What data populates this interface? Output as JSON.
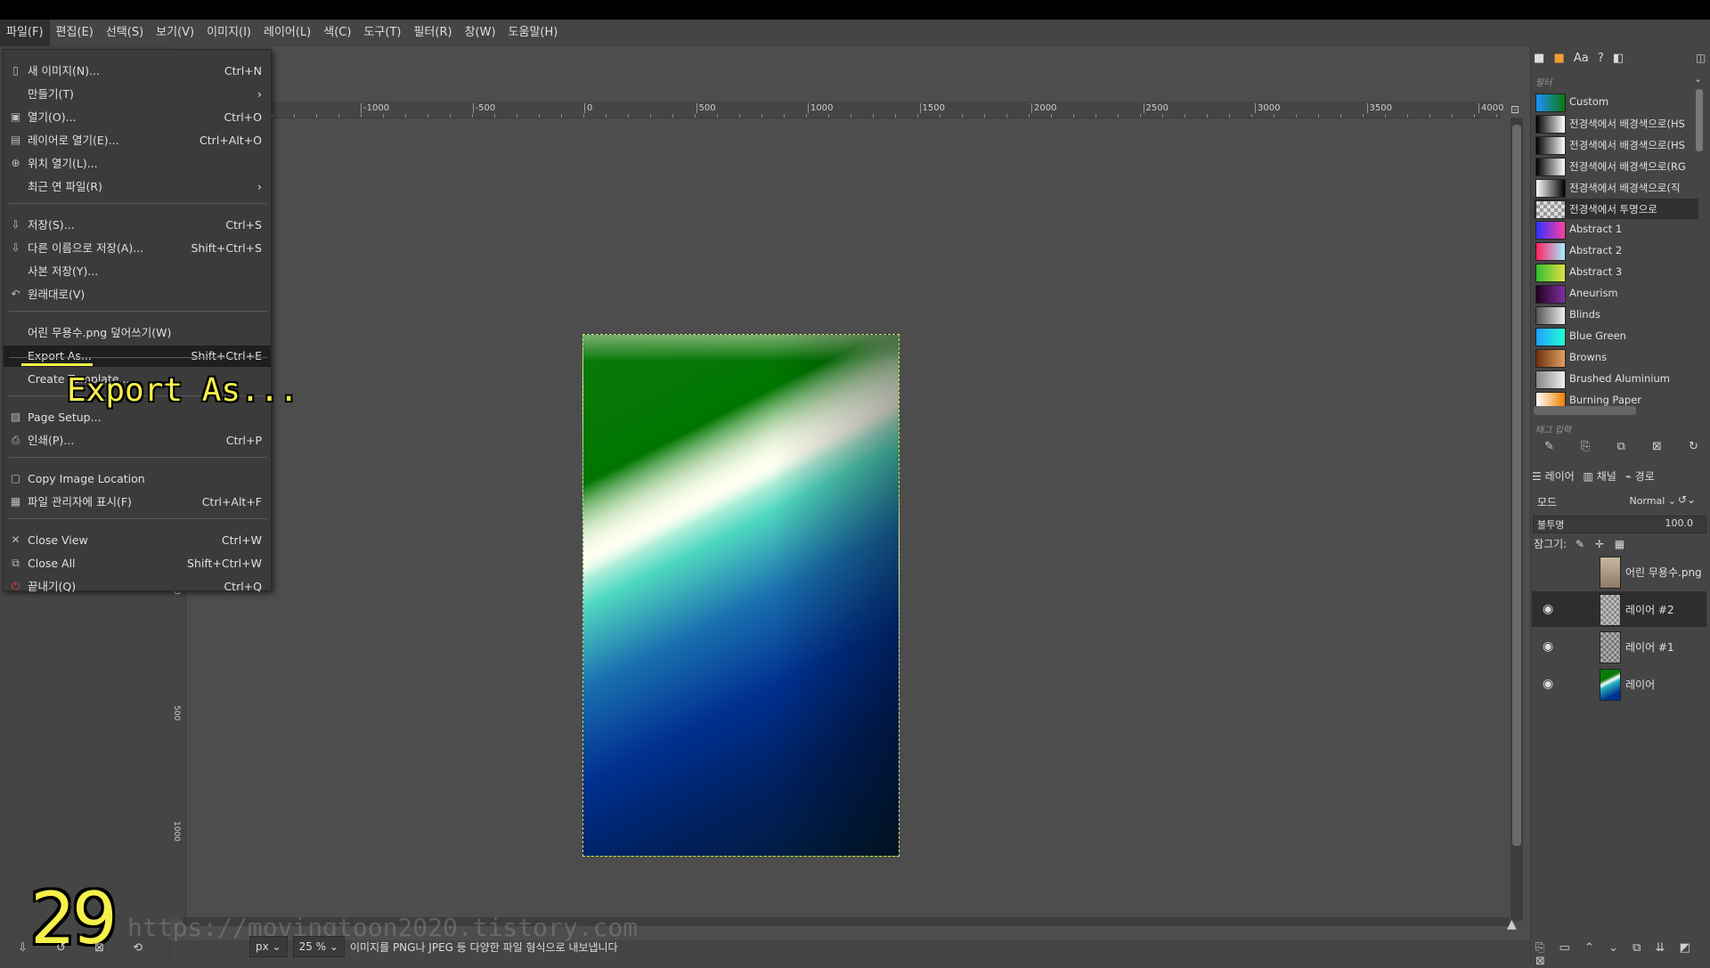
{
  "menubar": [
    "파일(F)",
    "편집(E)",
    "선택(S)",
    "보기(V)",
    "이미지(I)",
    "레이어(L)",
    "색(C)",
    "도구(T)",
    "필터(R)",
    "창(W)",
    "도움말(H)"
  ],
  "file_menu": [
    {
      "label": "새 이미지(N)...",
      "accel": "Ctrl+N",
      "icon": "new-image-icon"
    },
    {
      "label": "만들기(T)",
      "accel": "›",
      "icon": ""
    },
    {
      "label": "열기(O)...",
      "accel": "Ctrl+O",
      "icon": "open-icon"
    },
    {
      "label": "레이어로 열기(E)...",
      "accel": "Ctrl+Alt+O",
      "icon": "open-as-layer-icon"
    },
    {
      "label": "위치 열기(L)...",
      "accel": "",
      "icon": "open-location-icon"
    },
    {
      "label": "최근 연 파일(R)",
      "accel": "›",
      "icon": ""
    },
    {
      "label": "저장(S)...",
      "accel": "Ctrl+S",
      "icon": "save-icon"
    },
    {
      "label": "다른 이름으로 저장(A)...",
      "accel": "Shift+Ctrl+S",
      "icon": "save-as-icon"
    },
    {
      "label": "사본 저장(Y)...",
      "accel": "",
      "icon": ""
    },
    {
      "label": "원래대로(V)",
      "accel": "",
      "icon": "revert-icon"
    },
    {
      "label": "어린 무용수.png 덮어쓰기(W)",
      "accel": "",
      "icon": ""
    },
    {
      "label": "Export As...",
      "accel": "Shift+Ctrl+E",
      "icon": ""
    },
    {
      "label": "Create Template...",
      "accel": "",
      "icon": ""
    },
    {
      "label": "Page Setup...",
      "accel": "",
      "icon": "page-setup-icon"
    },
    {
      "label": "인쇄(P)...",
      "accel": "Ctrl+P",
      "icon": "print-icon"
    },
    {
      "label": "Copy Image Location",
      "accel": "",
      "icon": "copy-location-icon"
    },
    {
      "label": "파일 관리자에 표시(F)",
      "accel": "Ctrl+Alt+F",
      "icon": "file-manager-icon"
    },
    {
      "label": "Close View",
      "accel": "Ctrl+W",
      "icon": "close-icon"
    },
    {
      "label": "Close All",
      "accel": "Shift+Ctrl+W",
      "icon": "close-all-icon"
    },
    {
      "label": "끝내기(Q)",
      "accel": "Ctrl+Q",
      "icon": "quit-icon"
    }
  ],
  "overlay": {
    "export_caption": "Export As...",
    "step_number": "29",
    "watermark": "https://movingtoon2020.tistory.com"
  },
  "ruler_top_labels": [
    "-1000",
    "-500",
    "0",
    "500",
    "1000",
    "1500",
    "2000",
    "2500",
    "3000",
    "3500",
    "4000"
  ],
  "ruler_left_labels": [
    "0",
    "500",
    "1000"
  ],
  "statusbar": {
    "unit": "px",
    "zoom": "25 %",
    "message": "이미지를 PNG나 JPEG 등 다양한 파일 형식으로 내보냅니다"
  },
  "gradients": {
    "header": "필터",
    "tag_placeholder": "태그 입력",
    "items": [
      {
        "name": "Custom",
        "colors": [
          "#1e90ff",
          "#0a7a0a"
        ]
      },
      {
        "name": "전경색에서 배경색으로(HS",
        "colors": [
          "#000",
          "#fff"
        ]
      },
      {
        "name": "전경색에서 배경색으로(HS",
        "colors": [
          "#000",
          "#fff"
        ]
      },
      {
        "name": "전경색에서 배경색으로(RG",
        "colors": [
          "#000",
          "#fff"
        ]
      },
      {
        "name": "전경색에서 배경색으로(직",
        "colors": [
          "#fff",
          "#000"
        ]
      },
      {
        "name": "전경색에서 투명으로",
        "colors": [
          "#ddd",
          "#ddd"
        ]
      },
      {
        "name": "Abstract 1",
        "colors": [
          "#3030ff",
          "#ff40a0"
        ]
      },
      {
        "name": "Abstract 2",
        "colors": [
          "#ff2060",
          "#a0f0ff"
        ]
      },
      {
        "name": "Abstract 3",
        "colors": [
          "#30c030",
          "#e0e040"
        ]
      },
      {
        "name": "Aneurism",
        "colors": [
          "#200020",
          "#8030a0"
        ]
      },
      {
        "name": "Blinds",
        "colors": [
          "#555",
          "#eee"
        ]
      },
      {
        "name": "Blue Green",
        "colors": [
          "#20a0ff",
          "#20ffd0"
        ]
      },
      {
        "name": "Browns",
        "colors": [
          "#703010",
          "#e0a060"
        ]
      },
      {
        "name": "Brushed Aluminium",
        "colors": [
          "#888",
          "#eee"
        ]
      },
      {
        "name": "Burning Paper",
        "colors": [
          "#fff",
          "#f08000"
        ]
      }
    ]
  },
  "layers_panel": {
    "tabs": [
      "레이어",
      "채널",
      "경로"
    ],
    "mode_label": "모드",
    "mode_value": "Normal",
    "opacity_label": "불투명",
    "opacity_value": "100.0",
    "lock_label": "잠그기:",
    "layers": [
      {
        "name": "어린 무용수.png",
        "visible": false
      },
      {
        "name": "레이어 #2",
        "visible": true
      },
      {
        "name": "레이어 #1",
        "visible": true
      },
      {
        "name": "레이어",
        "visible": true
      }
    ]
  }
}
